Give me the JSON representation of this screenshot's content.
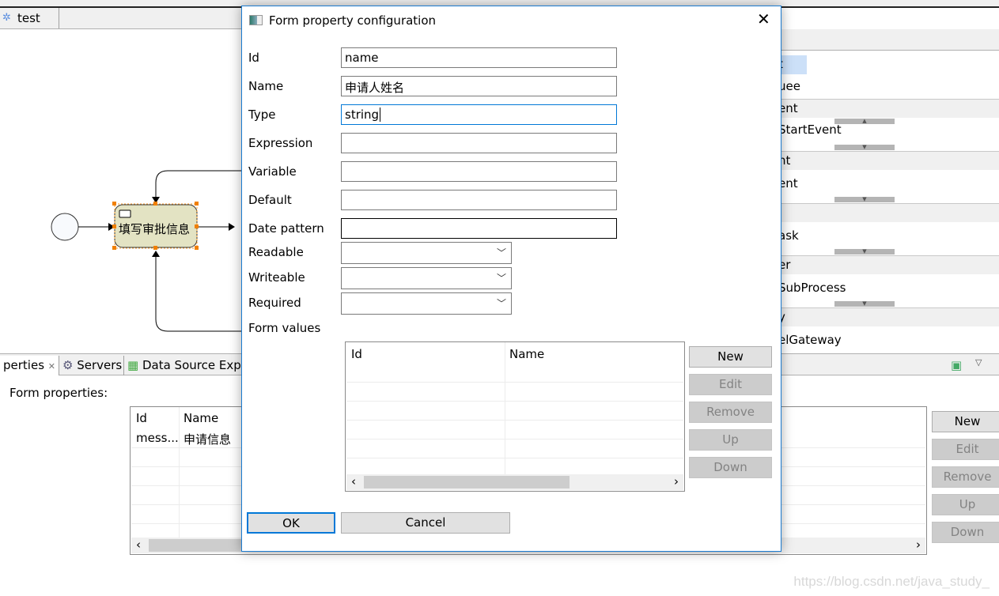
{
  "editor": {
    "tab_label": "test",
    "task_label": "填写审批信息"
  },
  "palette": {
    "fragments": [
      "t",
      "uee"
    ],
    "sections": [
      {
        "header": "ent",
        "items": [
          "StartEvent"
        ]
      },
      {
        "header": "nt",
        "items": [
          "ent"
        ]
      },
      {
        "header": "",
        "items": [
          "ask"
        ]
      },
      {
        "header": "er",
        "items": [
          "SubProcess"
        ]
      },
      {
        "header": "y",
        "items": [
          "elGateway"
        ]
      }
    ]
  },
  "bottom_panel": {
    "tabs": [
      "perties",
      "Servers",
      "Data Source Expl"
    ],
    "form_properties_label": "Form properties:",
    "table": {
      "columns": [
        "Id",
        "Name"
      ],
      "rows": [
        [
          "mess...",
          "申请信息"
        ]
      ]
    },
    "buttons": [
      "New",
      "Edit",
      "Remove",
      "Up",
      "Down"
    ]
  },
  "dialog": {
    "title": "Form property configuration",
    "fields": [
      {
        "label": "Id",
        "value": "name"
      },
      {
        "label": "Name",
        "value": "申请人姓名"
      },
      {
        "label": "Type",
        "value": "string"
      },
      {
        "label": "Expression",
        "value": ""
      },
      {
        "label": "Variable",
        "value": ""
      },
      {
        "label": "Default",
        "value": ""
      },
      {
        "label": "Date pattern",
        "value": ""
      }
    ],
    "combos": [
      {
        "label": "Readable",
        "value": ""
      },
      {
        "label": "Writeable",
        "value": ""
      },
      {
        "label": "Required",
        "value": ""
      }
    ],
    "form_values_label": "Form values",
    "table": {
      "columns": [
        "Id",
        "Name"
      ]
    },
    "buttons": [
      "New",
      "Edit",
      "Remove",
      "Up",
      "Down"
    ],
    "ok": "OK",
    "cancel": "Cancel"
  },
  "watermark": "https://blog.csdn.net/java_study_"
}
